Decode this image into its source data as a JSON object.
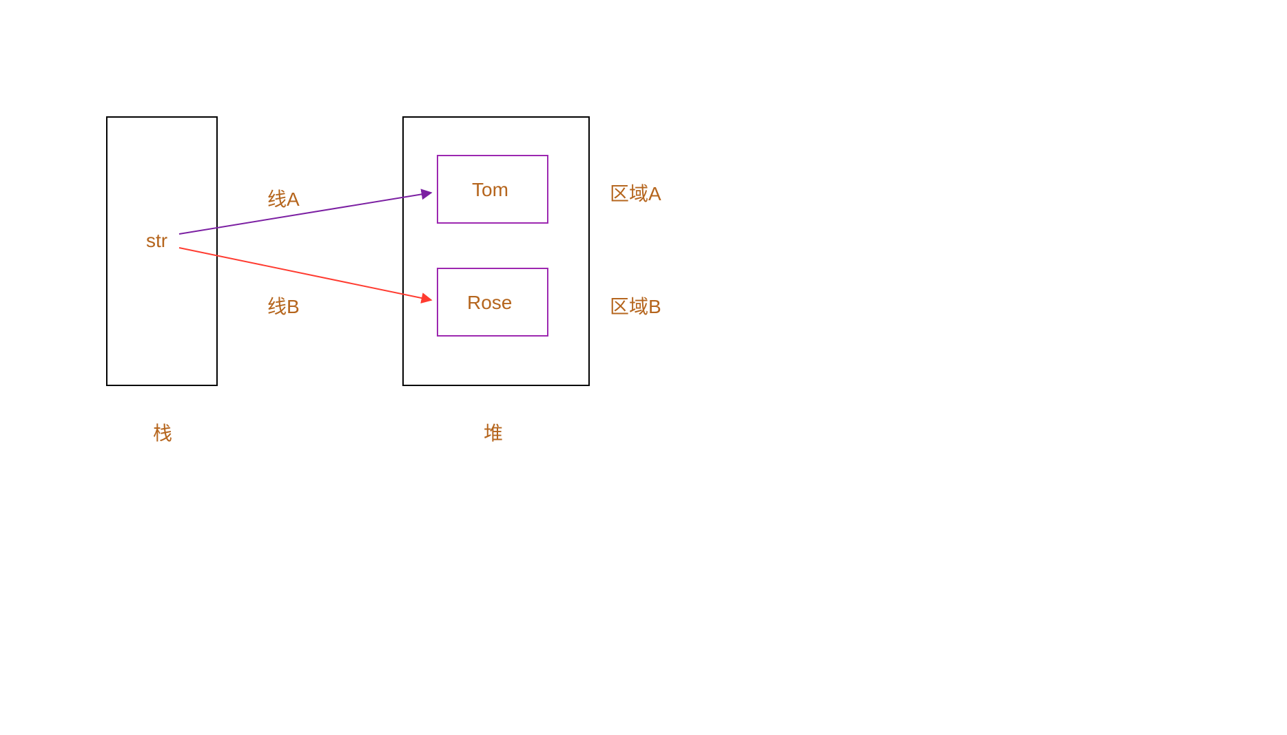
{
  "stack": {
    "label": "栈",
    "variable": "str"
  },
  "heap": {
    "label": "堆",
    "boxA": {
      "value": "Tom",
      "region_label": "区域A"
    },
    "boxB": {
      "value": "Rose",
      "region_label": "区域B"
    }
  },
  "arrows": {
    "a": {
      "label": "线A",
      "color": "#7B1FA2"
    },
    "b": {
      "label": "线B",
      "color": "#FF3B30"
    }
  },
  "colors": {
    "text": "#b5651d",
    "heap_inner_border": "#9C27B0",
    "box_border": "#000000"
  }
}
